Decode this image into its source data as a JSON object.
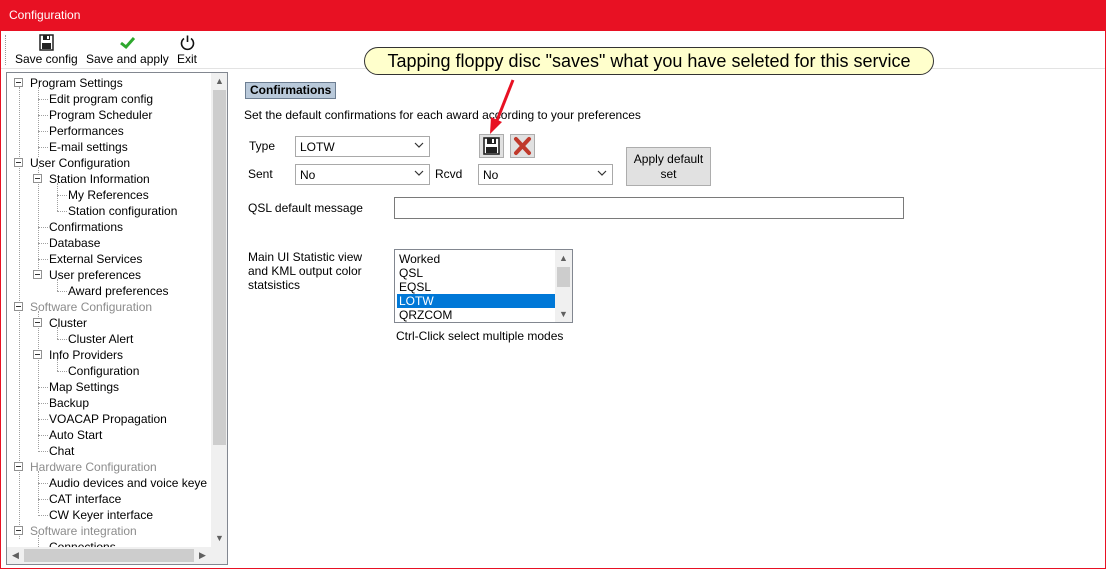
{
  "window": {
    "title": "Configuration",
    "accent": "#e81123"
  },
  "toolbar": {
    "save_config": {
      "label": "Save config",
      "icon": "floppy-disk-icon"
    },
    "save_apply": {
      "label": "Save and apply",
      "icon": "checkmark-icon"
    },
    "exit": {
      "label": "Exit",
      "icon": "power-icon"
    }
  },
  "tree": {
    "program_settings": "Program Settings",
    "edit_program_config": "Edit program config",
    "program_scheduler": "Program Scheduler",
    "performances": "Performances",
    "email_settings": "E-mail settings",
    "user_configuration": "User Configuration",
    "station_information": "Station Information",
    "my_references": "My References",
    "station_configuration": "Station configuration",
    "confirmations": "Confirmations",
    "database": "Database",
    "external_services": "External Services",
    "user_preferences": "User preferences",
    "award_preferences": "Award preferences",
    "software_configuration": "Software Configuration",
    "cluster": "Cluster",
    "cluster_alert": "Cluster Alert",
    "info_providers": "Info Providers",
    "configuration": "Configuration",
    "map_settings": "Map Settings",
    "backup": "Backup",
    "voacap_propagation": "VOACAP Propagation",
    "auto_start": "Auto Start",
    "chat": "Chat",
    "hardware_configuration": "Hardware Configuration",
    "audio_devices": "Audio devices and voice keye",
    "cat_interface": "CAT interface",
    "cw_keyer_interface": "CW Keyer interface",
    "software_integration": "Software integration",
    "connections": "Connections"
  },
  "main": {
    "section_title": "Confirmations",
    "description": "Set the default confirmations for each award according to your preferences",
    "type_label": "Type",
    "type_value": "LOTW",
    "sent_label": "Sent",
    "sent_value": "No",
    "rcvd_label": "Rcvd",
    "rcvd_value": "No",
    "apply_default_line1": "Apply default",
    "apply_default_line2": "set",
    "qsl_default_label": "QSL default message",
    "qsl_default_value": "",
    "stat_label_line1": "Main UI Statistic view",
    "stat_label_line2": "and KML output color",
    "stat_label_line3": "statsistics",
    "stat_options": [
      "Worked",
      "QSL",
      "EQSL",
      "LOTW",
      "QRZCOM"
    ],
    "stat_selected": "LOTW",
    "ctrl_hint": "Ctrl-Click select multiple modes"
  },
  "annotation": {
    "text": "Tapping floppy disc \"saves\" what you have seleted for this service",
    "arrow_color": "#e81123"
  }
}
